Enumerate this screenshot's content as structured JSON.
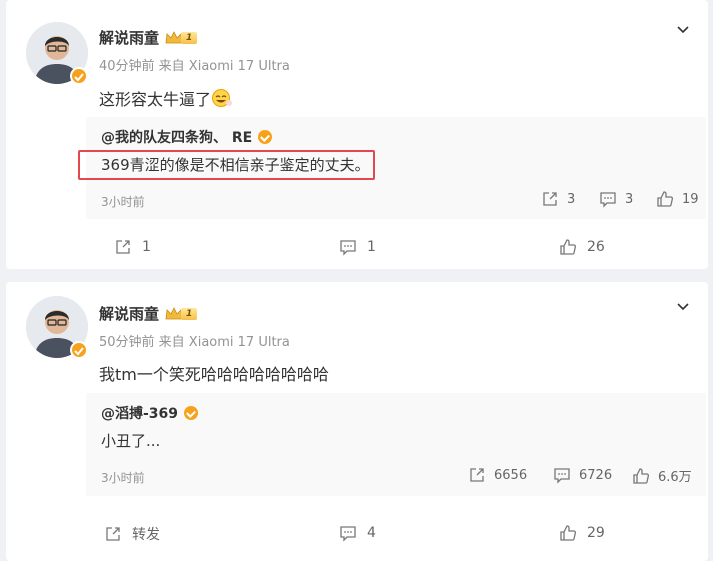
{
  "colors": {
    "accent": "#ff8200",
    "badge": "#f7a21c",
    "highlight": "#e2484e",
    "muted": "#939393"
  },
  "posts": [
    {
      "author": "解说雨童",
      "level": "1",
      "meta": "40分钟前 来自 Xiaomi 17 Ultra",
      "text": "这形容太牛逼了",
      "emoji": "laugh-emoji",
      "quote": {
        "author": "@我的队友四条狗、 RE",
        "text": "369青涩的像是不相信亲子鉴定的丈夫。",
        "time": "3小时前",
        "repost": "3",
        "comment": "3",
        "like": "19"
      },
      "repost": "1",
      "comment": "1",
      "like": "26"
    },
    {
      "author": "解说雨童",
      "level": "1",
      "meta": "50分钟前 来自 Xiaomi 17 Ultra",
      "text": "我tm一个笑死哈哈哈哈哈哈哈哈",
      "quote": {
        "author": "@滔搏-369",
        "text": "小丑了...",
        "time": "3小时前",
        "repost": "6656",
        "comment": "6726",
        "like": "6.6万"
      },
      "repost": "转发",
      "comment": "4",
      "like": "29"
    }
  ]
}
